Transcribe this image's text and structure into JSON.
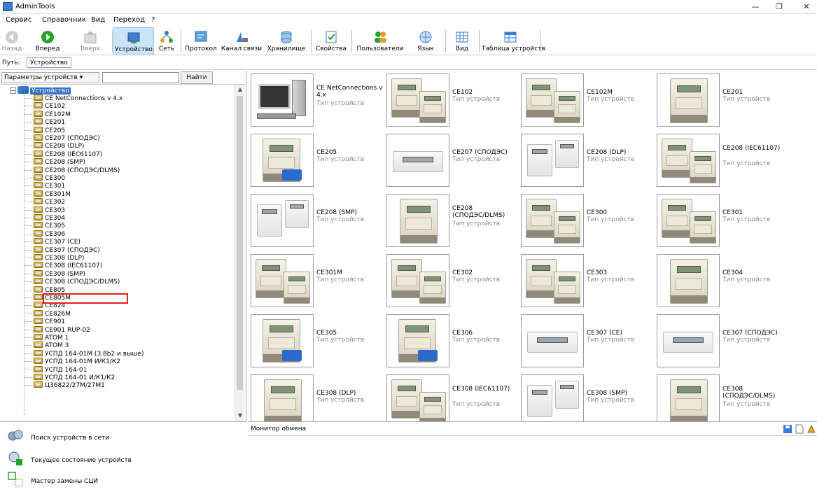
{
  "window": {
    "title": "AdminTools",
    "min": "—",
    "max": "❐",
    "close": "✕"
  },
  "menu": [
    "Сервис",
    "Справочник",
    "Вид",
    "Переход",
    "?"
  ],
  "toolbar": {
    "back": "Назад",
    "forward": "Вперед",
    "up": "Вверх",
    "device": "Устройство",
    "network": "Сеть",
    "protocol": "Протокол",
    "channel": "Канал связи",
    "storage": "Хранилище",
    "properties": "Свойства",
    "users": "Пользователи",
    "language": "Язык",
    "view": "Вид",
    "device_table": "Таблица устройств"
  },
  "path": {
    "label": "Путь:",
    "value": "Устройство"
  },
  "params": {
    "dropdown": "Параметры устройств ▾",
    "find": "Найти"
  },
  "tree": {
    "root": "Устройство",
    "items": [
      "CE NetConnections v 4.x",
      "CE102",
      "CE102M",
      "CE201",
      "CE205",
      "CE207 (СПОДЭС)",
      "CE208 (DLP)",
      "CE208 (IEC61107)",
      "CE208 (SMP)",
      "CE208 (СПОДЭС/DLMS)",
      "CE300",
      "CE301",
      "CE301M",
      "CE302",
      "CE303",
      "CE304",
      "CE305",
      "CE306",
      "CE307 (CE)",
      "CE307 (СПОДЭС)",
      "CE308 (DLP)",
      "CE308 (IEC61107)",
      "CE308 (SMP)",
      "CE308 (СПОДЭС/DLMS)",
      "CE805",
      "CE805M",
      "CE824",
      "CE826M",
      "CE901",
      "CE901 RUP-02",
      "ATOM 1",
      "ATOM 3",
      "УСПД 164-01М (3.8b2 и выше)",
      "УСПД 164-01М И/К1/К2",
      "УСПД 164-01",
      "УСПД 164-01 И/К1/К2",
      "Ц36822/27М/27М1"
    ]
  },
  "tasks": [
    "Поиск устройств в сети",
    "Текущее состояние устройств",
    "Мастер замены СЦИ"
  ],
  "grid": {
    "type_label": "Тип устройств",
    "cards": [
      {
        "name": "CE NetConnections v 4.x",
        "img": "pc"
      },
      {
        "name": "CE102",
        "img": "meter2"
      },
      {
        "name": "CE102M",
        "img": "meter2"
      },
      {
        "name": "CE201",
        "img": "meter"
      },
      {
        "name": "CE205",
        "img": "meter-card"
      },
      {
        "name": "CE207 (СПОДЭС)",
        "img": "din"
      },
      {
        "name": "CE208 (DLP)",
        "img": "split"
      },
      {
        "name": "CE208 (IEC61107)",
        "img": "meter2"
      },
      {
        "name": "CE208 (SMP)",
        "img": "split"
      },
      {
        "name": "CE208 (СПОДЭС/DLMS)",
        "img": "meter"
      },
      {
        "name": "CE300",
        "img": "meter2"
      },
      {
        "name": "CE301",
        "img": "meter2"
      },
      {
        "name": "CE301M",
        "img": "meter2"
      },
      {
        "name": "CE302",
        "img": "meter2"
      },
      {
        "name": "CE303",
        "img": "meter2"
      },
      {
        "name": "CE304",
        "img": "meter"
      },
      {
        "name": "CE305",
        "img": "meter-card"
      },
      {
        "name": "CE306",
        "img": "meter-card"
      },
      {
        "name": "CE307 (CE)",
        "img": "din"
      },
      {
        "name": "CE307 (СПОДЭС)",
        "img": "din"
      },
      {
        "name": "CE308 (DLP)",
        "img": "meter"
      },
      {
        "name": "CE308 (IEC61107)",
        "img": "meter2"
      },
      {
        "name": "CE308 (SMP)",
        "img": "split"
      },
      {
        "name": "CE308 (СПОДЭС/DLMS)",
        "img": "meter"
      }
    ]
  },
  "monitor": {
    "title": "Монитор обмена"
  }
}
